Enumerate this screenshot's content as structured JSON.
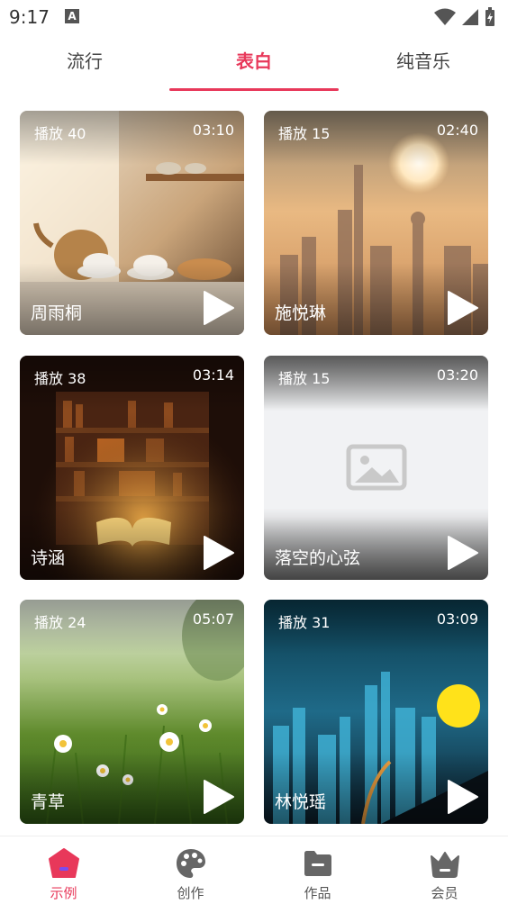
{
  "status": {
    "time": "9:17",
    "notif_glyph": "A"
  },
  "tabs": [
    {
      "label": "流行"
    },
    {
      "label": "表白",
      "active": true
    },
    {
      "label": "纯音乐"
    }
  ],
  "accent": "#e8385a",
  "cards": [
    {
      "plays": "播放 40",
      "duration": "03:10",
      "name": "周雨桐",
      "image": "cafe-teapot"
    },
    {
      "plays": "播放 15",
      "duration": "02:40",
      "name": "施悦琳",
      "image": "hazy-city-sun"
    },
    {
      "plays": "播放 38",
      "duration": "03:14",
      "name": "诗涵",
      "image": "library-book"
    },
    {
      "plays": "播放 15",
      "duration": "03:20",
      "name": "落空的心弦",
      "image": "image-placeholder-icon"
    },
    {
      "plays": "播放 24",
      "duration": "05:07",
      "name": "青草",
      "image": "daisy-meadow"
    },
    {
      "plays": "播放 31",
      "duration": "03:09",
      "name": "林悦瑶",
      "image": "night-city-sun"
    }
  ],
  "nav": [
    {
      "label": "示例",
      "icon": "home-icon",
      "active": true
    },
    {
      "label": "创作",
      "icon": "palette-icon"
    },
    {
      "label": "作品",
      "icon": "folder-icon"
    },
    {
      "label": "会员",
      "icon": "crown-icon"
    }
  ]
}
